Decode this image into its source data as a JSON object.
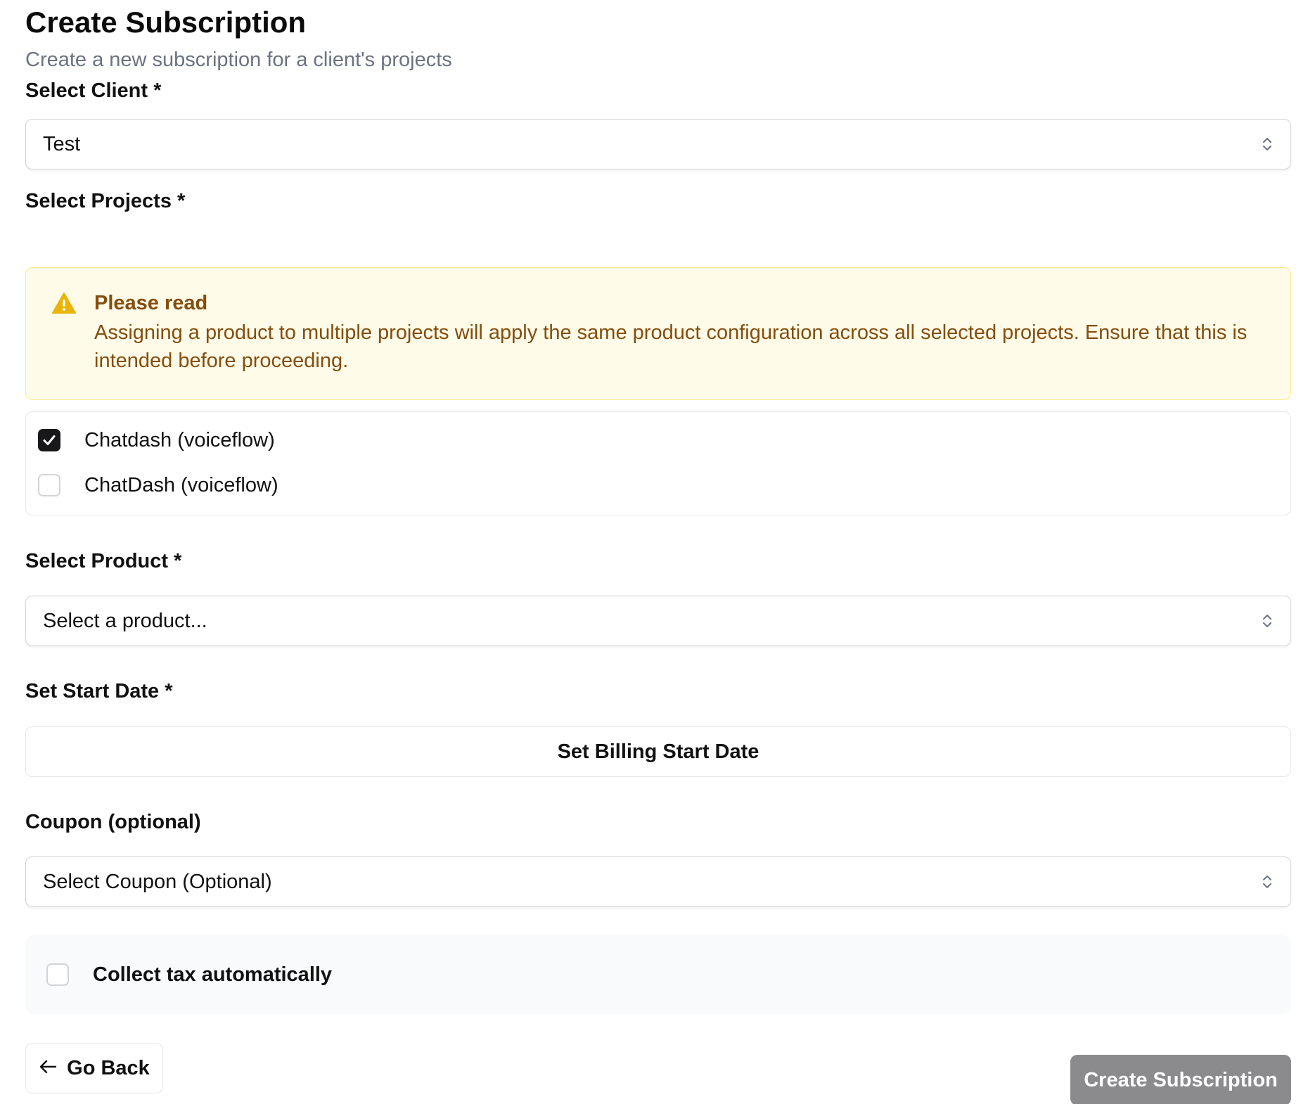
{
  "header": {
    "title": "Create Subscription",
    "subtitle": "Create a new subscription for a client's projects"
  },
  "client": {
    "label": "Select Client *",
    "value": "Test",
    "icon": "chevron-up-down-icon"
  },
  "projects": {
    "label": "Select Projects *",
    "alert": {
      "icon": "warning-triangle-icon",
      "title": "Please read",
      "body": "Assigning a product to multiple projects will apply the same product configuration across all selected projects. Ensure that this is intended before proceeding."
    },
    "items": [
      {
        "label": "Chatdash (voiceflow)",
        "checked": true
      },
      {
        "label": "ChatDash (voiceflow)",
        "checked": false
      }
    ]
  },
  "product": {
    "label": "Select Product *",
    "value": "Select a product..."
  },
  "start_date": {
    "label": "Set Start Date *",
    "button_label": "Set Billing Start Date"
  },
  "coupon": {
    "label": "Coupon (optional)",
    "value": "Select Coupon (Optional)"
  },
  "tax": {
    "label": "Collect tax automatically",
    "checked": false
  },
  "footer": {
    "back_label": "Go Back",
    "back_icon": "arrow-left-icon",
    "submit_label": "Create Subscription"
  },
  "colors": {
    "alert_bg": "#fefce8",
    "alert_border": "#fde68a",
    "alert_text": "#854d0e",
    "alert_icon": "#eab308",
    "submit_bg": "#8b8b8d",
    "checkbox_checked": "#18181b"
  }
}
